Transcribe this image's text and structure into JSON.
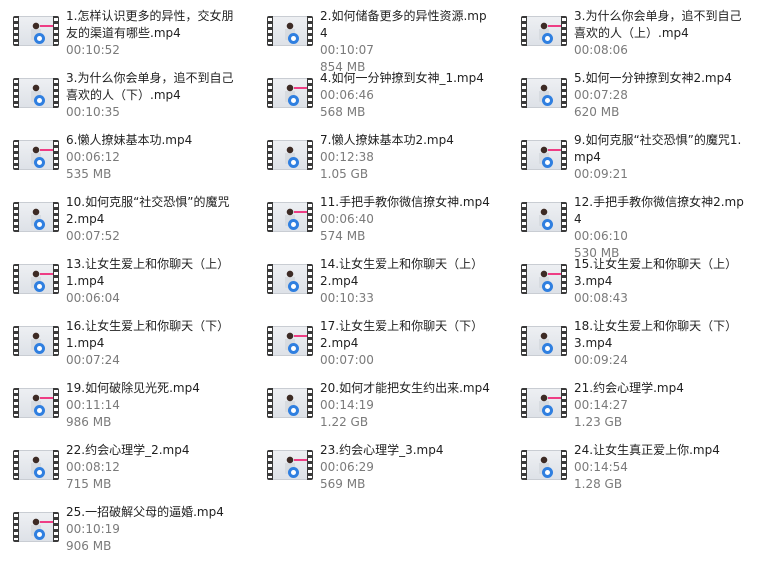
{
  "files": [
    {
      "name": "1.怎样认识更多的异性，交女朋友的渠道有哪些.mp4",
      "duration": "00:10:52",
      "size": ""
    },
    {
      "name": "2.如何储备更多的异性资源.mp4",
      "duration": "00:10:07",
      "size": "854 MB"
    },
    {
      "name": "3.为什么你会单身，追不到自己喜欢的人（上）.mp4",
      "duration": "00:08:06",
      "size": ""
    },
    {
      "name": "3.为什么你会单身，追不到自己喜欢的人（下）.mp4",
      "duration": "00:10:35",
      "size": ""
    },
    {
      "name": "4.如何一分钟撩到女神_1.mp4",
      "duration": "00:06:46",
      "size": "568 MB"
    },
    {
      "name": "5.如何一分钟撩到女神2.mp4",
      "duration": "00:07:28",
      "size": "620 MB"
    },
    {
      "name": "6.懒人撩妹基本功.mp4",
      "duration": "00:06:12",
      "size": "535 MB"
    },
    {
      "name": "7.懒人撩妹基本功2.mp4",
      "duration": "00:12:38",
      "size": "1.05 GB"
    },
    {
      "name": "9.如何克服“社交恐惧”的魔咒1.mp4",
      "duration": "00:09:21",
      "size": ""
    },
    {
      "name": "10.如何克服“社交恐惧”的魔咒2.mp4",
      "duration": "00:07:52",
      "size": ""
    },
    {
      "name": "11.手把手教你微信撩女神.mp4",
      "duration": "00:06:40",
      "size": "574 MB"
    },
    {
      "name": "12.手把手教你微信撩女神2.mp4",
      "duration": "00:06:10",
      "size": "530 MB"
    },
    {
      "name": "13.让女生爱上和你聊天（上）1.mp4",
      "duration": "00:06:04",
      "size": ""
    },
    {
      "name": "14.让女生爱上和你聊天（上）2.mp4",
      "duration": "00:10:33",
      "size": ""
    },
    {
      "name": "15.让女生爱上和你聊天（上）3.mp4",
      "duration": "00:08:43",
      "size": ""
    },
    {
      "name": "16.让女生爱上和你聊天（下）1.mp4",
      "duration": "00:07:24",
      "size": ""
    },
    {
      "name": "17.让女生爱上和你聊天（下）2.mp4",
      "duration": "00:07:00",
      "size": ""
    },
    {
      "name": "18.让女生爱上和你聊天（下）3.mp4",
      "duration": "00:09:24",
      "size": ""
    },
    {
      "name": "19.如何破除见光死.mp4",
      "duration": "00:11:14",
      "size": "986 MB"
    },
    {
      "name": "20.如何才能把女生约出来.mp4",
      "duration": "00:14:19",
      "size": "1.22 GB"
    },
    {
      "name": "21.约会心理学.mp4",
      "duration": "00:14:27",
      "size": "1.23 GB"
    },
    {
      "name": "22.约会心理学_2.mp4",
      "duration": "00:08:12",
      "size": "715 MB"
    },
    {
      "name": "23.约会心理学_3.mp4",
      "duration": "00:06:29",
      "size": "569 MB"
    },
    {
      "name": "24.让女生真正爱上你.mp4",
      "duration": "00:14:54",
      "size": "1.28 GB"
    },
    {
      "name": "25.一招破解父母的逼婚.mp4",
      "duration": "00:10:19",
      "size": "906 MB"
    }
  ]
}
